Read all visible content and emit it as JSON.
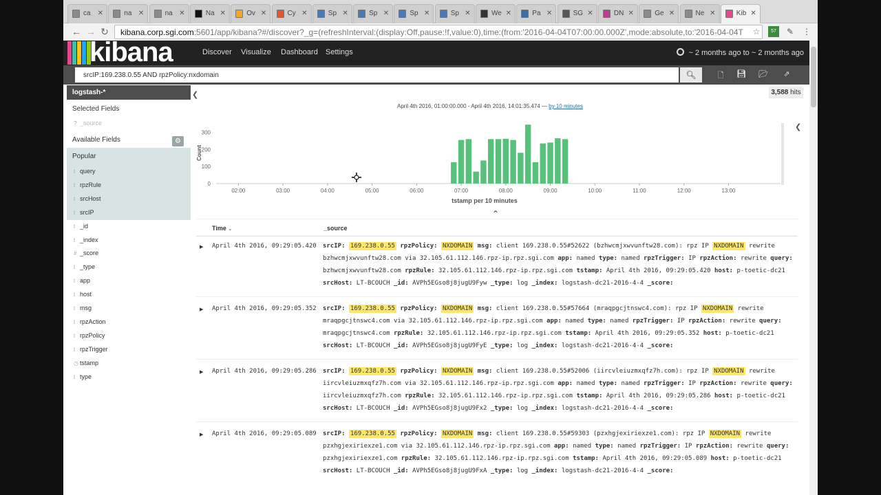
{
  "browser": {
    "tabs": [
      {
        "label": "ca",
        "fav": "#8a8a8a"
      },
      {
        "label": "na",
        "fav": "#8a8a8a"
      },
      {
        "label": "na",
        "fav": "#8a8a8a"
      },
      {
        "label": "Na",
        "fav": "#111111"
      },
      {
        "label": "Ov",
        "fav": "#f5a623"
      },
      {
        "label": "Cy",
        "fav": "#e2572c"
      },
      {
        "label": "Sp",
        "fav": "#4a7ab5"
      },
      {
        "label": "Sp",
        "fav": "#4a7ab5"
      },
      {
        "label": "Sp",
        "fav": "#4a7ab5"
      },
      {
        "label": "Sp",
        "fav": "#4a7ab5"
      },
      {
        "label": "We",
        "fav": "#333333"
      },
      {
        "label": "Pa",
        "fav": "#3b6ea5"
      },
      {
        "label": "SG",
        "fav": "#555555"
      },
      {
        "label": "DN",
        "fav": "#c03b8f"
      },
      {
        "label": "Ge",
        "fav": "#8a8a8a"
      },
      {
        "label": "Ne",
        "fav": "#8a8a8a"
      },
      {
        "label": "Kib",
        "fav": "#e8488b"
      }
    ],
    "url_host": "kibana.corp.sgi.com",
    "url_rest": ":5601/app/kibana?#/discover?_g=(refreshInterval:(display:Off,pause:!f,value:0),time:(from:'2016-04-04T07:00:00.000Z',mode:absolute,to:'2016-04-04T",
    "ext_badge": "57"
  },
  "kibana": {
    "logo": "kibana",
    "nav": [
      "Discover",
      "Visualize",
      "Dashboard",
      "Settings"
    ],
    "timepicker": "~ 2 months ago to ~ 2 months ago",
    "query": "srcIP:169.238.0.55 AND rpzPolicy:nxdomain",
    "logo_colors": [
      "#e8488b",
      "#3cbeb1",
      "#fec514",
      "#1ba9f5",
      "#93c90e"
    ]
  },
  "sidebar": {
    "index_pattern": "logstash-*",
    "selected_fields_label": "Selected Fields",
    "selected_fields": [
      {
        "type": "?",
        "name": "_source"
      }
    ],
    "available_fields_label": "Available Fields",
    "popular_label": "Popular",
    "popular_fields": [
      {
        "type": "t",
        "name": "query"
      },
      {
        "type": "t",
        "name": "rpzRule"
      },
      {
        "type": "t",
        "name": "srcHost"
      },
      {
        "type": "t",
        "name": "srcIP"
      }
    ],
    "other_fields": [
      {
        "type": "t",
        "name": "_id"
      },
      {
        "type": "t",
        "name": "_index"
      },
      {
        "type": "#",
        "name": "_score"
      },
      {
        "type": "t",
        "name": "_type"
      },
      {
        "type": "t",
        "name": "app"
      },
      {
        "type": "t",
        "name": "host"
      },
      {
        "type": "t",
        "name": "msg"
      },
      {
        "type": "t",
        "name": "rpzAction"
      },
      {
        "type": "t",
        "name": "rpzPolicy"
      },
      {
        "type": "t",
        "name": "rpzTrigger"
      },
      {
        "type": "◷",
        "name": "tstamp"
      },
      {
        "type": "t",
        "name": "type"
      }
    ]
  },
  "results": {
    "hits": "3,588",
    "hits_label": "hits",
    "range_text": "April 4th 2016, 01:00:00.000 - April 4th 2016, 14:01:35.474 —",
    "interval_link": "by 10 minutes",
    "col_time": "Time",
    "col_source": "_source"
  },
  "chart_data": {
    "type": "bar",
    "title": "",
    "xlabel": "tstamp per 10 minutes",
    "ylabel": "Count",
    "ylim": [
      0,
      350
    ],
    "yticks": [
      0,
      100,
      200,
      300
    ],
    "x_ticks": [
      "02:00",
      "03:00",
      "04:00",
      "05:00",
      "06:00",
      "07:00",
      "08:00",
      "09:00",
      "10:00",
      "11:00",
      "12:00",
      "13:00"
    ],
    "x_range": [
      "01:30",
      "14:10"
    ],
    "bar_color": "#57c17b",
    "bars": [
      {
        "x": "06:50",
        "value": 125
      },
      {
        "x": "07:00",
        "value": 255
      },
      {
        "x": "07:10",
        "value": 260
      },
      {
        "x": "07:20",
        "value": 70
      },
      {
        "x": "07:30",
        "value": 135
      },
      {
        "x": "07:40",
        "value": 260
      },
      {
        "x": "07:50",
        "value": 260
      },
      {
        "x": "08:00",
        "value": 262
      },
      {
        "x": "08:10",
        "value": 255
      },
      {
        "x": "08:20",
        "value": 180
      },
      {
        "x": "08:30",
        "value": 345
      },
      {
        "x": "08:40",
        "value": 125
      },
      {
        "x": "08:50",
        "value": 235
      },
      {
        "x": "09:00",
        "value": 240
      },
      {
        "x": "09:10",
        "value": 265
      },
      {
        "x": "09:20",
        "value": 260
      }
    ]
  },
  "docs": [
    {
      "time": "April 4th 2016, 09:29:05.420",
      "parts": [
        [
          "srcIP:",
          "169.238.0.55",
          "hl"
        ],
        [
          "rpzPolicy:",
          "NXDOMAIN",
          "hl"
        ],
        [
          "msg:",
          "client 169.238.0.55#52622 (bzhwcmjxwvunftw28.com): rpz IP ",
          ""
        ],
        [
          "",
          "NXDOMAIN",
          "hl"
        ],
        [
          "",
          " rewrite bzhwcmjxwvunftw28.com via 32.105.61.112.146.rpz-ip.rpz.sgi.com",
          ""
        ],
        [
          "app:",
          "named",
          ""
        ],
        [
          "type:",
          "named",
          ""
        ],
        [
          "rpzTrigger:",
          "IP",
          ""
        ],
        [
          "rpzAction:",
          "rewrite",
          ""
        ],
        [
          "query:",
          "bzhwcmjxwvunftw28.com",
          ""
        ],
        [
          "rpzRule:",
          "32.105.61.112.146.rpz-ip.rpz.sgi.com",
          ""
        ],
        [
          "tstamp:",
          "April 4th 2016, 09:29:05.420",
          ""
        ],
        [
          "host:",
          "p-toetic-dc21",
          ""
        ],
        [
          "srcHost:",
          "LT-BCOUCH",
          ""
        ],
        [
          "_id:",
          "AVPh5EGso8j8jugU9Fyw",
          ""
        ],
        [
          "_type:",
          "log",
          ""
        ],
        [
          "_index:",
          "logstash-dc21-2016-4-4",
          ""
        ],
        [
          "_score:",
          "",
          ""
        ]
      ]
    },
    {
      "time": "April 4th 2016, 09:29:05.352",
      "parts": [
        [
          "srcIP:",
          "169.238.0.55",
          "hl"
        ],
        [
          "rpzPolicy:",
          "NXDOMAIN",
          "hl"
        ],
        [
          "msg:",
          "client 169.238.0.55#57664 (mraqpgcjtnswc4.com): rpz IP ",
          ""
        ],
        [
          "",
          "NXDOMAIN",
          "hl"
        ],
        [
          "",
          " rewrite mraqpgcjtnswc4.com via 32.105.61.112.146.rpz-ip.rpz.sgi.com",
          ""
        ],
        [
          "app:",
          "named",
          ""
        ],
        [
          "type:",
          "named",
          ""
        ],
        [
          "rpzTrigger:",
          "IP",
          ""
        ],
        [
          "rpzAction:",
          "rewrite",
          ""
        ],
        [
          "query:",
          "mraqpgcjtnswc4.com",
          ""
        ],
        [
          "rpzRule:",
          "32.105.61.112.146.rpz-ip.rpz.sgi.com",
          ""
        ],
        [
          "tstamp:",
          "April 4th 2016, 09:29:05.352",
          ""
        ],
        [
          "host:",
          "p-toetic-dc21",
          ""
        ],
        [
          "srcHost:",
          "LT-BCOUCH",
          ""
        ],
        [
          "_id:",
          "AVPh5EGso8j8jugU9FyE",
          ""
        ],
        [
          "_type:",
          "log",
          ""
        ],
        [
          "_index:",
          "logstash-dc21-2016-4-4",
          ""
        ],
        [
          "_score:",
          "",
          ""
        ]
      ]
    },
    {
      "time": "April 4th 2016, 09:29:05.286",
      "parts": [
        [
          "srcIP:",
          "169.238.0.55",
          "hl"
        ],
        [
          "rpzPolicy:",
          "NXDOMAIN",
          "hl"
        ],
        [
          "msg:",
          "client 169.238.0.55#52006 (iircvleiuzmxqfz7h.com): rpz IP ",
          ""
        ],
        [
          "",
          "NXDOMAIN",
          "hl"
        ],
        [
          "",
          " rewrite iircvleiuzmxqfz7h.com via 32.105.61.112.146.rpz-ip.rpz.sgi.com",
          ""
        ],
        [
          "app:",
          "named",
          ""
        ],
        [
          "type:",
          "named",
          ""
        ],
        [
          "rpzTrigger:",
          "IP",
          ""
        ],
        [
          "rpzAction:",
          "rewrite",
          ""
        ],
        [
          "query:",
          "iircvleiuzmxqfz7h.com",
          ""
        ],
        [
          "rpzRule:",
          "32.105.61.112.146.rpz-ip.rpz.sgi.com",
          ""
        ],
        [
          "tstamp:",
          "April 4th 2016, 09:29:05.286",
          ""
        ],
        [
          "host:",
          "p-toetic-dc21",
          ""
        ],
        [
          "srcHost:",
          "LT-BCOUCH",
          ""
        ],
        [
          "_id:",
          "AVPh5EGso8j8jugU9Fx2",
          ""
        ],
        [
          "_type:",
          "log",
          ""
        ],
        [
          "_index:",
          "logstash-dc21-2016-4-4",
          ""
        ],
        [
          "_score:",
          "",
          ""
        ]
      ]
    },
    {
      "time": "April 4th 2016, 09:29:05.089",
      "parts": [
        [
          "srcIP:",
          "169.238.0.55",
          "hl"
        ],
        [
          "rpzPolicy:",
          "NXDOMAIN",
          "hl"
        ],
        [
          "msg:",
          "client 169.238.0.55#59303 (pzxhgjexiriexze1.com): rpz IP ",
          ""
        ],
        [
          "",
          "NXDOMAIN",
          "hl"
        ],
        [
          "",
          " rewrite pzxhgjexiriexze1.com via 32.105.61.112.146.rpz-ip.rpz.sgi.com",
          ""
        ],
        [
          "app:",
          "named",
          ""
        ],
        [
          "type:",
          "named",
          ""
        ],
        [
          "rpzTrigger:",
          "IP",
          ""
        ],
        [
          "rpzAction:",
          "rewrite",
          ""
        ],
        [
          "query:",
          "pzxhgjexiriexze1.com",
          ""
        ],
        [
          "rpzRule:",
          "32.105.61.112.146.rpz-ip.rpz.sgi.com",
          ""
        ],
        [
          "tstamp:",
          "April 4th 2016, 09:29:05.089",
          ""
        ],
        [
          "host:",
          "p-toetic-dc21",
          ""
        ],
        [
          "srcHost:",
          "LT-BCOUCH",
          ""
        ],
        [
          "_id:",
          "AVPh5EGso8j8jugU9FxA",
          ""
        ],
        [
          "_type:",
          "log",
          ""
        ],
        [
          "_index:",
          "logstash-dc21-2016-4-4",
          ""
        ],
        [
          "_score:",
          "",
          ""
        ]
      ]
    }
  ]
}
